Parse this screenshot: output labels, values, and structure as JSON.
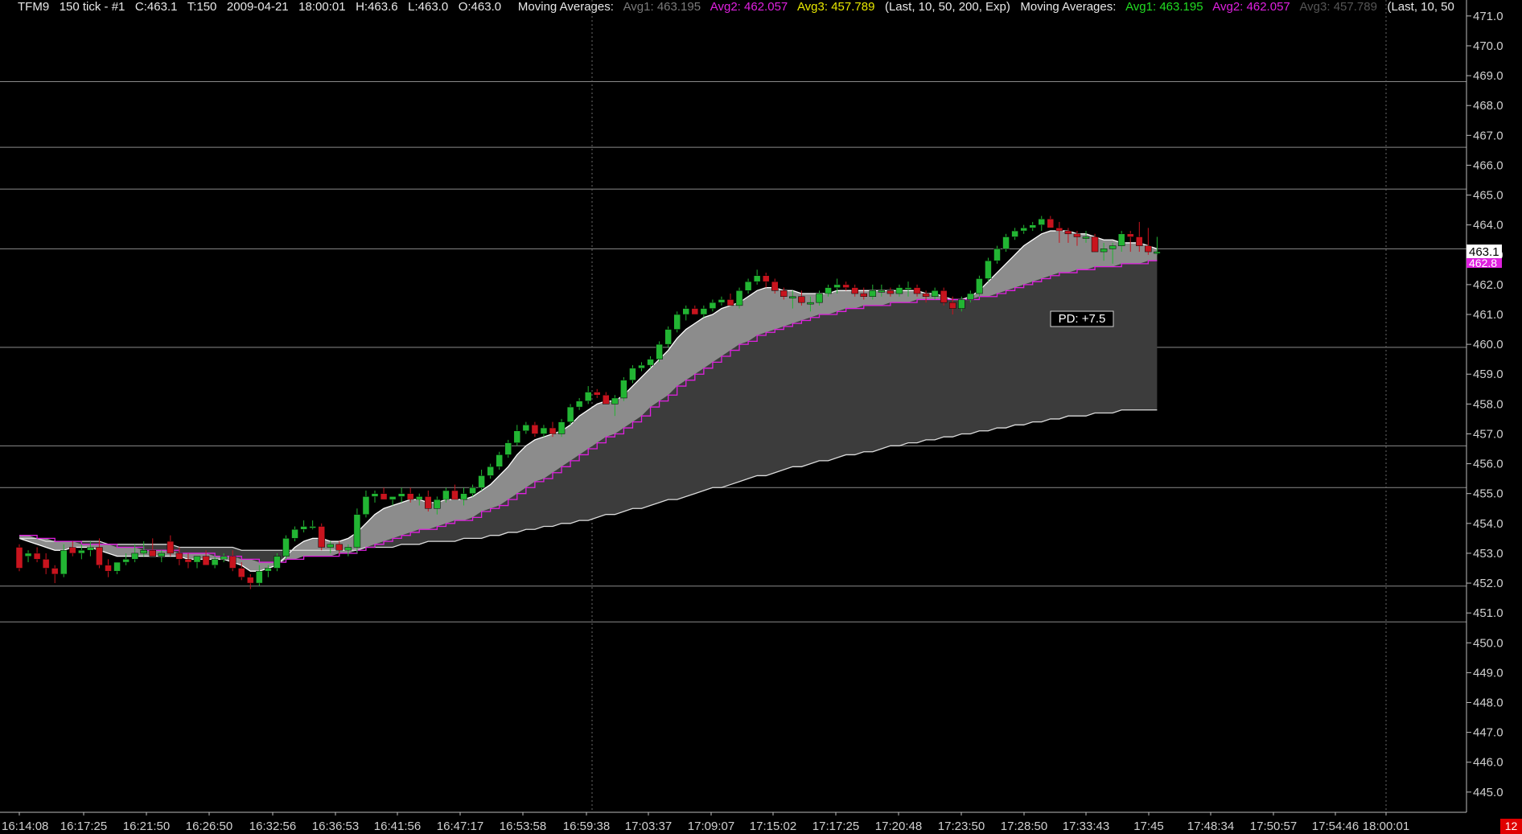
{
  "header": {
    "symbol": "TFM9",
    "interval": "150 tick - #1",
    "close": "C:463.1",
    "ticks": "T:150",
    "date": "2009-04-21",
    "time": "18:00:01",
    "high": "H:463.6",
    "low": "L:463.0",
    "open": "O:463.0",
    "study1": {
      "label": "Moving Averages:",
      "avg1_label": "Avg1:",
      "avg1_value": "463.195",
      "avg2_label": "Avg2:",
      "avg2_value": "462.057",
      "avg3_label": "Avg3:",
      "avg3_value": "457.789",
      "params": "(Last, 10, 50, 200, Exp)"
    },
    "study2": {
      "label": "Moving Averages:",
      "avg1_label": "Avg1:",
      "avg1_value": "463.195",
      "avg2_label": "Avg2:",
      "avg2_value": "462.057",
      "avg3_label": "Avg3:",
      "avg3_value": "457.789",
      "params": "(Last, 10, 50"
    }
  },
  "colors": {
    "background": "#000000",
    "up_candle": "#22b533",
    "down_candle": "#c8141e",
    "avg1_text": "#22dd22",
    "avg2_line": "#e020e0",
    "avg3_text": "#e8e800",
    "dimmed_text": "#7a7a7a",
    "fill_light": "#8c8c8c",
    "fill_dark": "#3c3c3c",
    "gridline": "#8a8a8a",
    "last_price_box": "#ffffff",
    "avg2_box": "#e020e0"
  },
  "price_tags": {
    "last": "463.1",
    "avg2": "462.8"
  },
  "annotation": {
    "text": "PD: +7.5"
  },
  "corner_badge": "12",
  "chart_data": {
    "type": "candlestick",
    "y_range": [
      444.7,
      471.4
    ],
    "y_ticks": [
      "445.0",
      "446.0",
      "447.0",
      "448.0",
      "449.0",
      "450.0",
      "451.0",
      "452.0",
      "453.0",
      "454.0",
      "455.0",
      "456.0",
      "457.0",
      "458.0",
      "459.0",
      "460.0",
      "461.0",
      "462.0",
      "463.0",
      "464.0",
      "465.0",
      "466.0",
      "467.0",
      "468.0",
      "469.0",
      "470.0",
      "471.0"
    ],
    "x_tick_labels": [
      "16:14:08",
      "16:17:25",
      "16:21:50",
      "16:26:50",
      "16:32:56",
      "16:36:53",
      "16:41:56",
      "16:47:17",
      "16:53:58",
      "16:59:38",
      "17:03:37",
      "17:09:07",
      "17:15:02",
      "17:17:25",
      "17:20:48",
      "17:23:50",
      "17:28:50",
      "17:33:43",
      "17:45",
      "17:48:34",
      "17:50:57",
      "17:54:46",
      "18:00:01"
    ],
    "horizontal_lines": [
      468.8,
      466.6,
      465.2,
      463.2,
      459.9,
      456.6,
      455.2,
      451.9,
      450.7
    ],
    "vertical_lines": [
      "16:59:38",
      "18:00:01"
    ],
    "candles": {
      "open": [
        453.2,
        452.9,
        453.0,
        452.8,
        452.5,
        452.3,
        453.2,
        453.0,
        453.1,
        453.2,
        452.6,
        452.4,
        452.7,
        452.8,
        453.0,
        453.1,
        452.9,
        453.4,
        453.0,
        452.8,
        452.7,
        452.9,
        452.6,
        452.8,
        452.9,
        452.5,
        452.2,
        452.0,
        452.4,
        452.5,
        452.9,
        453.5,
        453.8,
        453.9,
        453.9,
        453.2,
        453.3,
        453.1,
        453.2,
        454.3,
        454.9,
        455.0,
        454.8,
        454.9,
        455.0,
        454.8,
        454.9,
        454.5,
        454.8,
        455.1,
        454.8,
        455.0,
        455.2,
        455.6,
        455.9,
        456.3,
        456.7,
        457.1,
        457.3,
        457.0,
        457.2,
        457.0,
        457.4,
        457.9,
        458.1,
        458.4,
        458.3,
        458.0,
        458.2,
        458.8,
        459.2,
        459.3,
        459.5,
        460.0,
        460.5,
        461.0,
        461.2,
        461.0,
        461.2,
        461.4,
        461.5,
        461.3,
        461.8,
        462.1,
        462.3,
        462.1,
        461.8,
        461.6,
        461.6,
        461.4,
        461.4,
        461.7,
        461.9,
        462.0,
        461.9,
        461.7,
        461.6,
        461.8,
        461.8,
        461.7,
        461.9,
        461.9,
        461.7,
        461.6,
        461.8,
        461.4,
        461.2,
        461.5,
        461.7,
        462.2,
        462.8,
        463.2,
        463.6,
        463.8,
        463.9,
        464.0,
        464.2,
        463.9,
        463.8,
        463.7,
        463.6,
        463.6,
        463.1,
        463.2,
        463.3,
        463.7,
        463.6,
        463.3,
        463.1
      ],
      "high": [
        453.3,
        453.1,
        453.2,
        453.0,
        452.6,
        453.3,
        453.4,
        453.3,
        453.4,
        453.5,
        452.8,
        452.7,
        453.0,
        453.3,
        453.4,
        453.5,
        453.1,
        453.6,
        453.2,
        453.0,
        452.9,
        453.1,
        452.9,
        453.0,
        453.1,
        452.7,
        452.3,
        452.6,
        452.6,
        453.0,
        453.6,
        453.9,
        454.1,
        454.1,
        454.0,
        453.4,
        453.4,
        453.3,
        454.5,
        455.1,
        455.1,
        455.2,
        454.9,
        455.2,
        455.2,
        455.0,
        455.1,
        454.9,
        455.2,
        455.3,
        455.2,
        455.3,
        455.8,
        456.0,
        456.4,
        456.8,
        457.3,
        457.4,
        457.4,
        457.3,
        457.4,
        457.5,
        458.0,
        458.2,
        458.6,
        458.5,
        458.4,
        458.3,
        458.9,
        459.3,
        459.4,
        459.6,
        460.1,
        460.6,
        461.1,
        461.3,
        461.3,
        461.3,
        461.5,
        461.6,
        461.7,
        461.9,
        462.2,
        462.5,
        462.4,
        462.2,
        461.9,
        461.8,
        461.8,
        461.6,
        461.8,
        462.0,
        462.2,
        462.1,
        462.0,
        461.9,
        462.0,
        462.0,
        461.9,
        462.0,
        462.1,
        462.0,
        461.8,
        461.9,
        461.9,
        461.6,
        461.6,
        461.8,
        462.3,
        462.9,
        463.3,
        463.7,
        463.9,
        464.0,
        464.1,
        464.3,
        464.3,
        464.1,
        463.9,
        463.8,
        463.8,
        463.7,
        463.4,
        463.4,
        463.8,
        463.8,
        464.1,
        463.9,
        463.6
      ],
      "low": [
        452.4,
        452.7,
        452.7,
        452.3,
        452.0,
        452.2,
        452.9,
        452.8,
        452.9,
        452.5,
        452.2,
        452.3,
        452.6,
        452.7,
        452.9,
        452.9,
        452.7,
        452.9,
        452.6,
        452.5,
        452.5,
        452.6,
        452.5,
        452.7,
        452.4,
        452.1,
        451.8,
        451.9,
        452.2,
        452.4,
        452.8,
        453.4,
        453.7,
        453.8,
        453.1,
        453.0,
        453.0,
        452.9,
        453.0,
        454.2,
        454.7,
        454.8,
        454.6,
        454.7,
        454.7,
        454.6,
        454.4,
        454.3,
        454.7,
        454.8,
        454.6,
        454.9,
        455.1,
        455.5,
        455.8,
        456.2,
        456.6,
        457.0,
        456.9,
        456.9,
        456.9,
        456.9,
        457.3,
        457.8,
        458.0,
        458.2,
        458.1,
        457.6,
        458.1,
        458.7,
        459.1,
        459.2,
        459.4,
        459.9,
        460.4,
        460.8,
        461.0,
        460.9,
        461.1,
        461.3,
        461.3,
        461.2,
        461.7,
        462.0,
        461.9,
        461.7,
        461.5,
        461.2,
        461.3,
        461.1,
        461.3,
        461.6,
        461.7,
        461.8,
        461.6,
        461.5,
        461.5,
        461.6,
        461.6,
        461.6,
        461.6,
        461.6,
        461.4,
        461.5,
        461.3,
        461.0,
        461.1,
        461.4,
        461.6,
        462.1,
        462.7,
        463.1,
        463.5,
        463.7,
        463.8,
        463.8,
        463.9,
        463.4,
        463.4,
        463.3,
        463.4,
        463.1,
        462.8,
        462.7,
        463.1,
        463.1,
        463.1,
        463.0,
        463.0
      ],
      "close": [
        452.5,
        453.0,
        452.8,
        452.5,
        452.3,
        453.1,
        453.0,
        453.1,
        453.2,
        452.6,
        452.4,
        452.7,
        452.8,
        453.0,
        453.1,
        452.9,
        453.0,
        453.0,
        452.8,
        452.7,
        452.9,
        452.6,
        452.8,
        452.9,
        452.5,
        452.2,
        452.0,
        452.4,
        452.5,
        452.9,
        453.5,
        453.8,
        453.9,
        453.9,
        453.2,
        453.3,
        453.1,
        453.2,
        454.3,
        454.9,
        455.0,
        454.8,
        454.9,
        455.0,
        454.8,
        454.9,
        454.5,
        454.8,
        455.1,
        454.8,
        455.0,
        455.2,
        455.6,
        455.9,
        456.3,
        456.7,
        457.1,
        457.3,
        457.0,
        457.2,
        457.0,
        457.4,
        457.9,
        458.1,
        458.4,
        458.3,
        458.0,
        458.2,
        458.8,
        459.2,
        459.3,
        459.5,
        460.0,
        460.5,
        461.0,
        461.2,
        461.0,
        461.2,
        461.4,
        461.5,
        461.3,
        461.8,
        462.1,
        462.3,
        462.1,
        461.8,
        461.6,
        461.6,
        461.4,
        461.4,
        461.7,
        461.9,
        462.0,
        461.9,
        461.7,
        461.6,
        461.8,
        461.8,
        461.7,
        461.9,
        461.9,
        461.7,
        461.6,
        461.8,
        461.4,
        461.2,
        461.5,
        461.7,
        462.2,
        462.8,
        463.2,
        463.6,
        463.8,
        463.9,
        464.0,
        464.2,
        463.9,
        463.8,
        463.7,
        463.6,
        463.6,
        463.1,
        463.2,
        463.3,
        463.7,
        463.6,
        463.3,
        463.1,
        463.1
      ]
    },
    "series": [
      {
        "name": "Avg1",
        "values": [
          453.5,
          453.4,
          453.3,
          453.2,
          453.1,
          453.1,
          453.2,
          453.2,
          453.2,
          453.1,
          453.0,
          452.9,
          452.9,
          452.9,
          452.9,
          452.9,
          452.9,
          452.9,
          452.9,
          452.8,
          452.8,
          452.8,
          452.8,
          452.8,
          452.7,
          452.6,
          452.4,
          452.4,
          452.5,
          452.6,
          452.9,
          453.2,
          453.4,
          453.5,
          453.5,
          453.4,
          453.4,
          453.5,
          453.7,
          454.0,
          454.3,
          454.5,
          454.6,
          454.7,
          454.8,
          454.8,
          454.7,
          454.7,
          454.8,
          454.8,
          454.8,
          454.9,
          455.1,
          455.3,
          455.6,
          455.9,
          456.3,
          456.6,
          456.8,
          456.9,
          457.0,
          457.1,
          457.3,
          457.6,
          457.8,
          458.0,
          458.1,
          458.1,
          458.3,
          458.6,
          458.9,
          459.2,
          459.5,
          459.8,
          460.2,
          460.5,
          460.7,
          460.9,
          461.0,
          461.2,
          461.3,
          461.4,
          461.6,
          461.8,
          461.9,
          461.9,
          461.8,
          461.8,
          461.7,
          461.7,
          461.7,
          461.7,
          461.8,
          461.8,
          461.8,
          461.8,
          461.8,
          461.8,
          461.8,
          461.8,
          461.8,
          461.8,
          461.7,
          461.7,
          461.6,
          461.5,
          461.5,
          461.6,
          461.8,
          462.1,
          462.4,
          462.7,
          463.0,
          463.3,
          463.5,
          463.7,
          463.8,
          463.8,
          463.8,
          463.7,
          463.7,
          463.6,
          463.5,
          463.5,
          463.4,
          463.4,
          463.4,
          463.3,
          463.2
        ]
      },
      {
        "name": "Avg2",
        "values": [
          453.6,
          453.6,
          453.5,
          453.5,
          453.4,
          453.4,
          453.4,
          453.3,
          453.3,
          453.3,
          453.3,
          453.2,
          453.2,
          453.2,
          453.1,
          453.1,
          453.1,
          453.1,
          453.0,
          453.0,
          453.0,
          453.0,
          452.9,
          452.9,
          452.9,
          452.8,
          452.8,
          452.7,
          452.7,
          452.7,
          452.8,
          452.8,
          452.9,
          452.9,
          452.9,
          452.9,
          453.0,
          453.0,
          453.1,
          453.2,
          453.3,
          453.4,
          453.5,
          453.6,
          453.7,
          453.8,
          453.8,
          453.9,
          454.0,
          454.1,
          454.1,
          454.2,
          454.4,
          454.5,
          454.6,
          454.8,
          455.0,
          455.2,
          455.4,
          455.5,
          455.7,
          455.9,
          456.1,
          456.3,
          456.5,
          456.7,
          456.9,
          457.0,
          457.2,
          457.4,
          457.6,
          457.9,
          458.1,
          458.3,
          458.6,
          458.8,
          459.0,
          459.2,
          459.4,
          459.6,
          459.8,
          460.0,
          460.1,
          460.3,
          460.4,
          460.5,
          460.6,
          460.7,
          460.8,
          460.9,
          461.0,
          461.0,
          461.1,
          461.2,
          461.2,
          461.3,
          461.3,
          461.3,
          461.4,
          461.4,
          461.4,
          461.5,
          461.5,
          461.5,
          461.5,
          461.5,
          461.5,
          461.5,
          461.6,
          461.6,
          461.7,
          461.8,
          461.9,
          462.0,
          462.1,
          462.2,
          462.3,
          462.4,
          462.4,
          462.5,
          462.5,
          462.6,
          462.6,
          462.6,
          462.7,
          462.7,
          462.7,
          462.8,
          462.8
        ]
      },
      {
        "name": "Avg3",
        "values": [
          453.5,
          453.5,
          453.5,
          453.4,
          453.4,
          453.4,
          453.4,
          453.4,
          453.4,
          453.4,
          453.3,
          453.3,
          453.3,
          453.3,
          453.3,
          453.3,
          453.3,
          453.3,
          453.2,
          453.2,
          453.2,
          453.2,
          453.2,
          453.2,
          453.2,
          453.1,
          453.1,
          453.1,
          453.1,
          453.1,
          453.1,
          453.1,
          453.1,
          453.1,
          453.1,
          453.1,
          453.1,
          453.1,
          453.1,
          453.2,
          453.2,
          453.2,
          453.2,
          453.3,
          453.3,
          453.3,
          453.4,
          453.4,
          453.4,
          453.4,
          453.5,
          453.5,
          453.5,
          453.6,
          453.6,
          453.7,
          453.7,
          453.8,
          453.8,
          453.9,
          453.9,
          454.0,
          454.0,
          454.1,
          454.1,
          454.2,
          454.3,
          454.3,
          454.4,
          454.5,
          454.5,
          454.6,
          454.7,
          454.8,
          454.8,
          454.9,
          455.0,
          455.1,
          455.2,
          455.2,
          455.3,
          455.4,
          455.5,
          455.6,
          455.6,
          455.7,
          455.8,
          455.9,
          455.9,
          456.0,
          456.1,
          456.1,
          456.2,
          456.3,
          456.3,
          456.4,
          456.4,
          456.5,
          456.6,
          456.6,
          456.7,
          456.7,
          456.8,
          456.8,
          456.9,
          456.9,
          457.0,
          457.0,
          457.1,
          457.1,
          457.2,
          457.2,
          457.3,
          457.3,
          457.4,
          457.4,
          457.5,
          457.5,
          457.6,
          457.6,
          457.6,
          457.7,
          457.7,
          457.7,
          457.8,
          457.8,
          457.8,
          457.8,
          457.8
        ]
      }
    ]
  }
}
